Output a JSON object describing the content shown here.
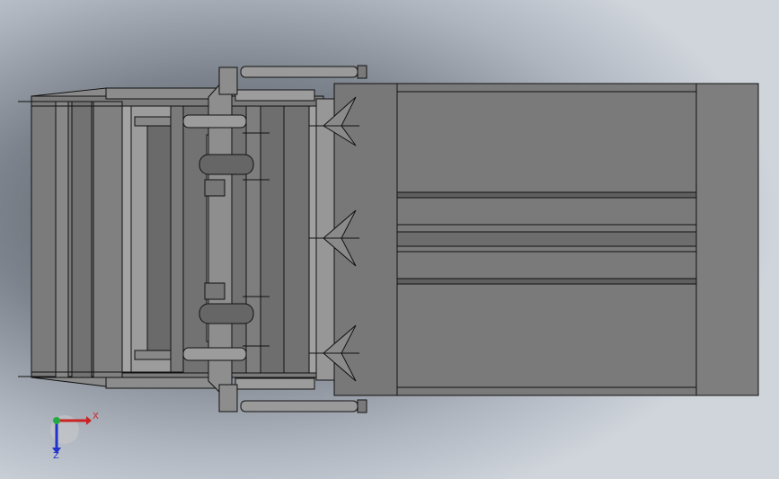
{
  "scene": {
    "background_colors": [
      "#4f535a",
      "#7d838c",
      "#aeb5bf",
      "#d0d5dc"
    ],
    "body_fill": "#777777",
    "light_fill": "#9a9a9a",
    "dark_fill": "#666666",
    "edge_color": "#111111"
  },
  "triad": {
    "x_label": "X",
    "z_label": "Z",
    "x_color": "#cc2222",
    "y_color": "#22aa44",
    "z_color": "#2233cc"
  }
}
